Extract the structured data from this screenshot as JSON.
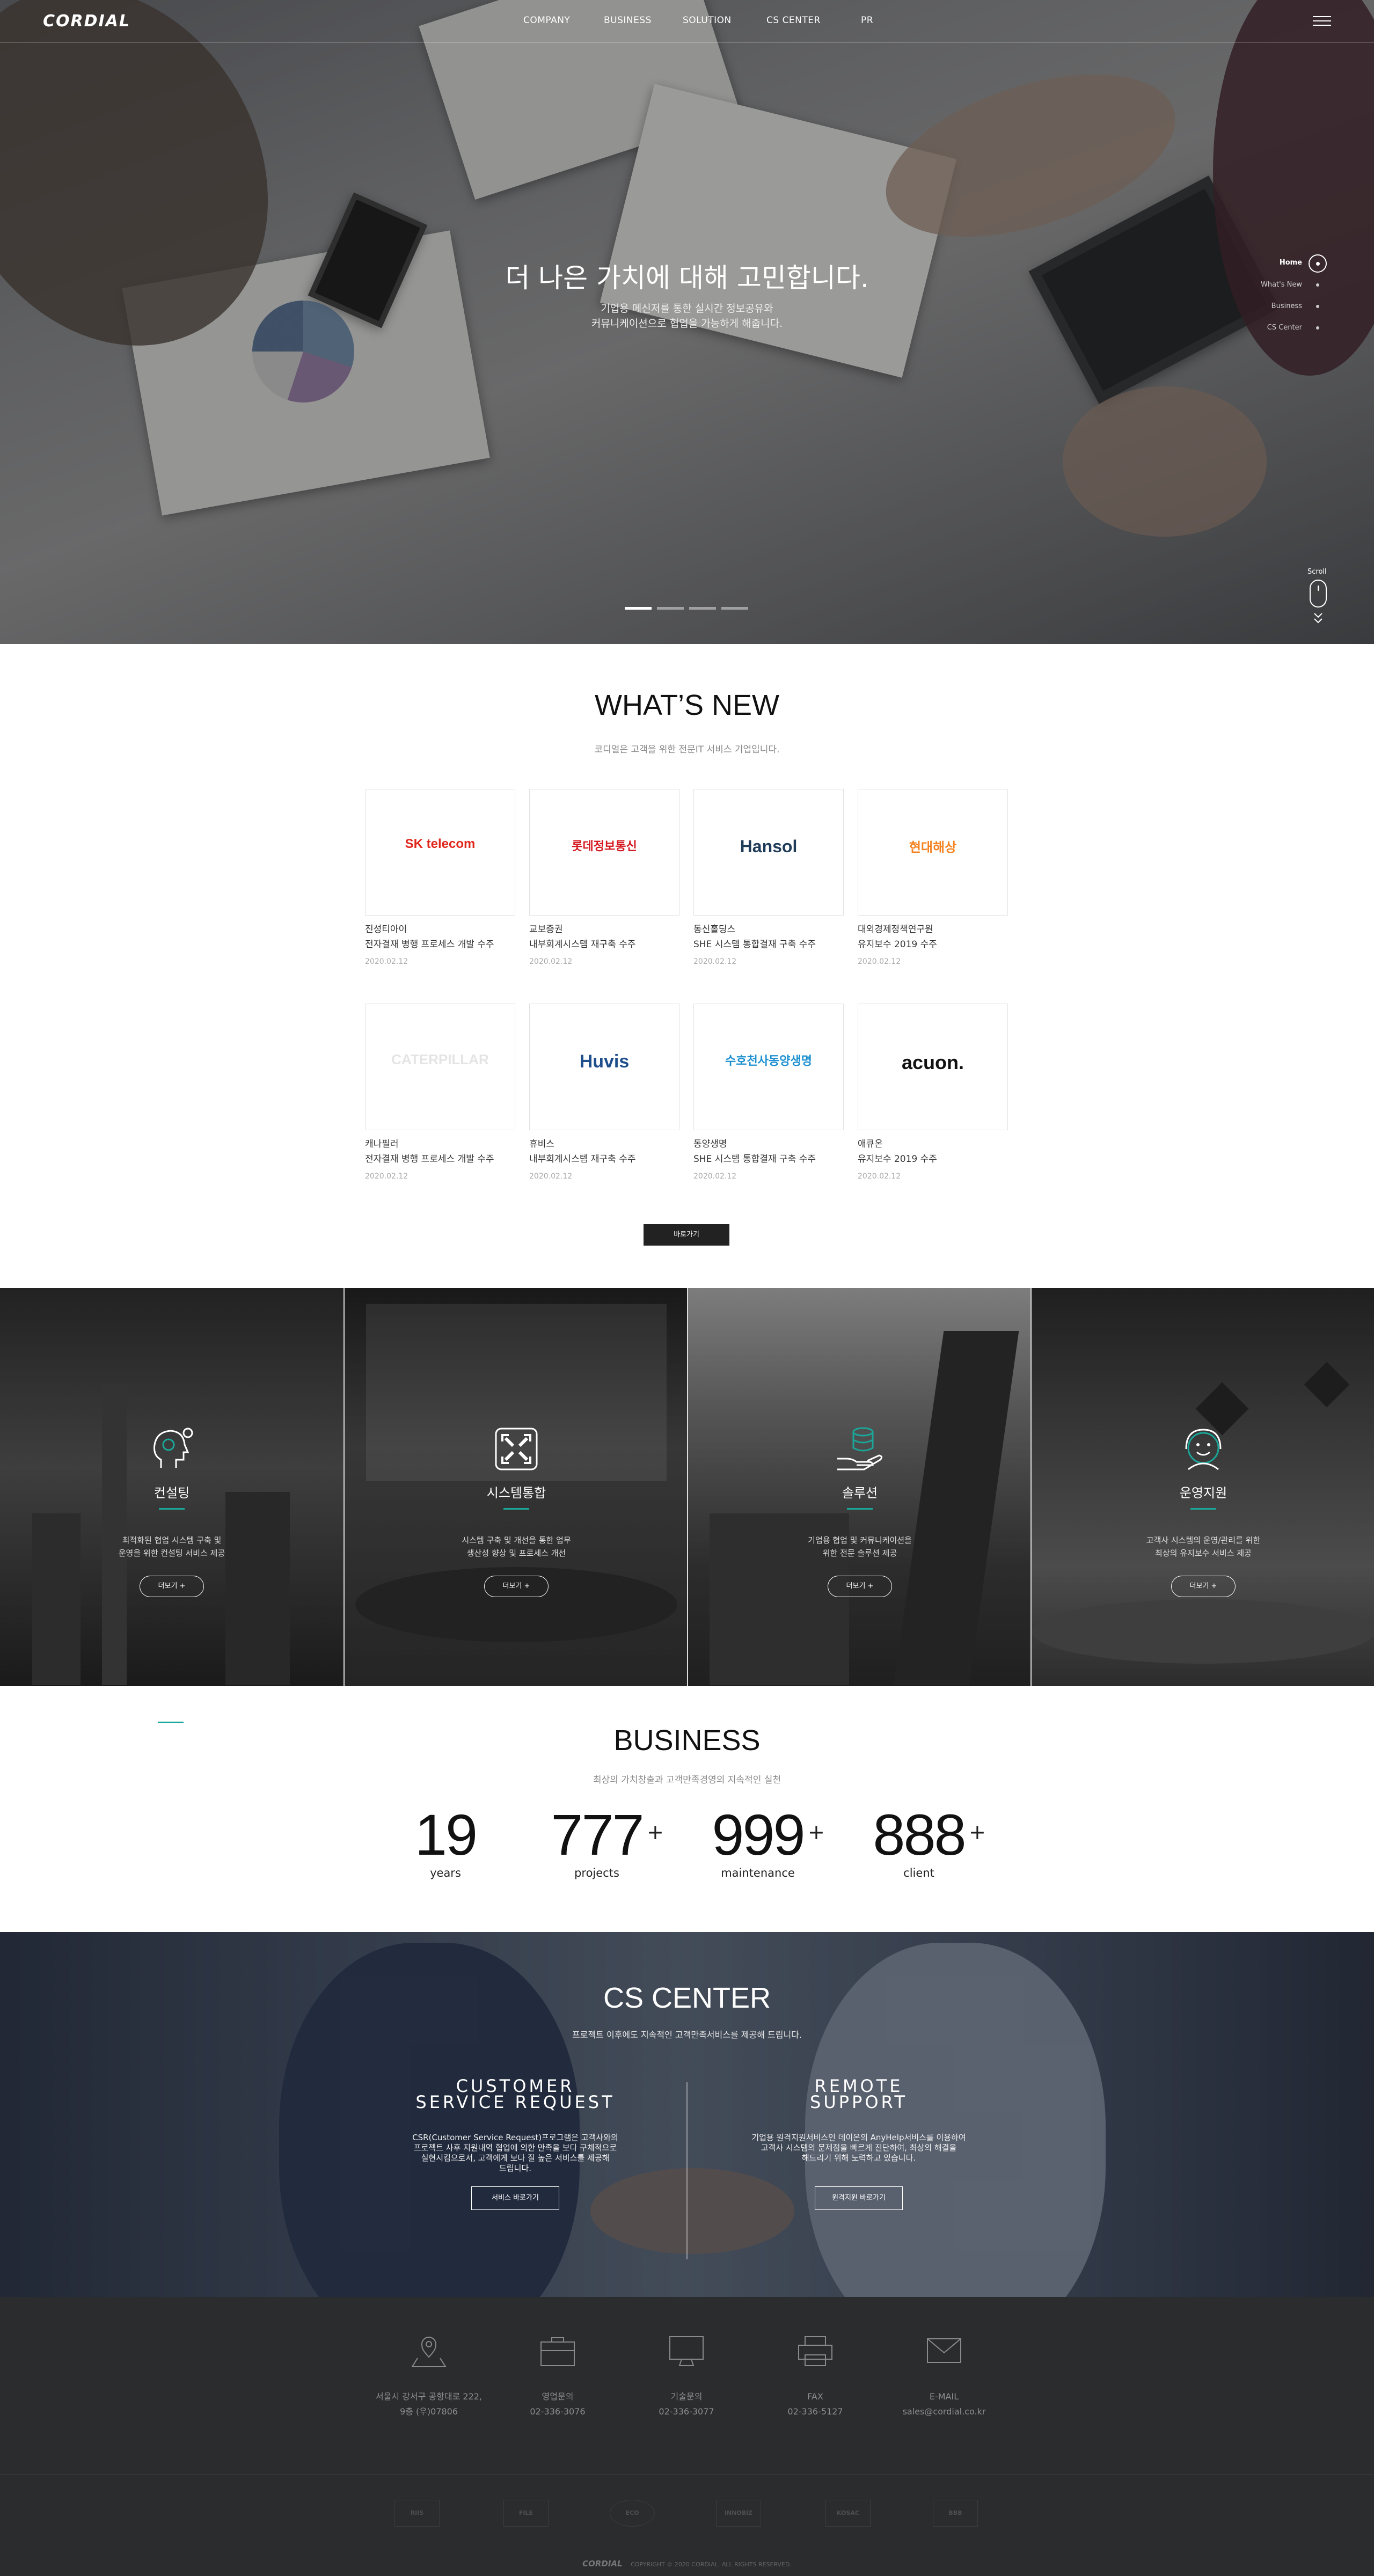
{
  "header": {
    "logo": "CORDIAL",
    "nav": [
      "COMPANY",
      "BUSINESS",
      "SOLUTION",
      "CS CENTER",
      "PR"
    ]
  },
  "hero": {
    "title": "더 나은 가치에 대해 고민합니다.",
    "subtitle_line1": "기업용 메신저를 통한 실시간 정보공유와",
    "subtitle_line2": "커뮤니케이션으로 협업을 가능하게 해줍니다.",
    "side_nav": [
      "Home",
      "What's New",
      "Business",
      "CS Center"
    ],
    "scroll_label": "Scroll",
    "slide_count": 4,
    "active_slide": 1
  },
  "whats_new": {
    "title": "WHAT’S NEW",
    "subtitle": "코디얼은 고객을 위한 전문IT 서비스 기업입니다.",
    "more_label": "바로가기",
    "items": [
      {
        "logo": "SK telecom",
        "company": "진성티아이",
        "desc": "전자결재 병행 프로세스 개발 수주",
        "date": "2020.02.12"
      },
      {
        "logo": "롯데정보통신",
        "company": "교보증권",
        "desc": "내부회계시스템 재구축 수주",
        "date": "2020.02.12"
      },
      {
        "logo": "Hansol",
        "company": "동신홀딩스",
        "desc": "SHE 시스템 통합결재 구축 수주",
        "date": "2020.02.12"
      },
      {
        "logo": "현대해상",
        "company": "대외경제정책연구원",
        "desc": "유지보수 2019 수주",
        "date": "2020.02.12"
      },
      {
        "logo": "CATERPILLAR",
        "company": "캐나필러",
        "desc": "전자결재 병행 프로세스 개발 수주",
        "date": "2020.02.12"
      },
      {
        "logo": "Huvis",
        "company": "휴비스",
        "desc": "내부회계시스템 재구축 수주",
        "date": "2020.02.12"
      },
      {
        "logo": "수호천사동양생명",
        "company": "동양생명",
        "desc": "SHE 시스템 통합결재 구축 수주",
        "date": "2020.02.12"
      },
      {
        "logo": "acuon.",
        "company": "애큐온",
        "desc": "유지보수 2019 수주",
        "date": "2020.02.12"
      }
    ]
  },
  "services": [
    {
      "name": "컨설팅",
      "desc1": "최적화된 협업 시스템 구축 및",
      "desc2": "운영을 위한 컨설팅 서비스 제공",
      "button": "더보기",
      "icon": "head-gear-icon"
    },
    {
      "name": "시스템통합",
      "desc1": "시스템 구축 및 개선을 통한 업무",
      "desc2": "생산성 향상 및 프로세스 개선",
      "button": "더보기",
      "icon": "arrows-out-icon"
    },
    {
      "name": "솔루션",
      "desc1": "기업용 협업 및 커뮤니케이션을",
      "desc2": "위한 전문 솔루션 제공",
      "button": "더보기",
      "icon": "hand-database-icon"
    },
    {
      "name": "운영지원",
      "desc1": "고객사 시스템의 운영/관리를 위한",
      "desc2": "최상의 유지보수 서비스 제공",
      "button": "더보기",
      "icon": "support-face-icon"
    }
  ],
  "business": {
    "title": "BUSINESS",
    "subtitle": "최상의 가치창출과 고객만족경영의 지속적인 실천",
    "stats": [
      {
        "number": "19",
        "plus": "",
        "label": "years"
      },
      {
        "number": "777",
        "plus": "+",
        "label": "projects"
      },
      {
        "number": "999",
        "plus": "+",
        "label": "maintenance"
      },
      {
        "number": "888",
        "plus": "+",
        "label": "client"
      }
    ]
  },
  "cs_center": {
    "title": "CS CENTER",
    "subtitle": "프로젝트 이후에도 지속적인 고객만족서비스를 제공해 드립니다.",
    "left": {
      "heading1": "CUSTOMER",
      "heading2": "SERVICE REQUEST",
      "desc1": "CSR(Customer Service Request)프로그램은 고객사와의",
      "desc2": "프로젝트 사후 지원내역 협업에 의한 만족을 보다 구체적으로",
      "desc3": "실현시킴으로서, 고객에게 보다 질 높은 서비스를 제공해",
      "desc4": "드립니다.",
      "button": "서비스 바로가기"
    },
    "right": {
      "heading1": "REMOTE",
      "heading2": "SUPPORT",
      "desc1": "기업용 원격지원서비스인 데이온의 AnyHelp서비스를 이용하여",
      "desc2": "고객사 시스템의 문제점을 빠르게 진단하여, 최상의 해결을",
      "desc3": "해드리기 위해 노력하고 있습니다.",
      "button": "원격지원 바로가기"
    }
  },
  "footer": {
    "contacts": [
      {
        "icon": "map-pin-icon",
        "line1": "서울시 강서구 공항대로 222,",
        "line2": "9층 (우)07806"
      },
      {
        "icon": "briefcase-icon",
        "line1": "영업문의",
        "line2": "02-336-3076"
      },
      {
        "icon": "monitor-icon",
        "line1": "기술문의",
        "line2": "02-336-3077"
      },
      {
        "icon": "printer-icon",
        "line1": "FAX",
        "line2": "02-336-5127"
      },
      {
        "icon": "envelope-icon",
        "line1": "E-MAIL",
        "line2": "sales@cordial.co.kr"
      }
    ],
    "partners": [
      "RIIS",
      "FILE",
      "ECO",
      "INNOBIZ",
      "KOSAC",
      "BBB"
    ],
    "copyright_logo": "CORDIAL",
    "copyright": "COPYRIGHT © 2020 CORDIAL. ALL RIGHTS RESERVED."
  }
}
